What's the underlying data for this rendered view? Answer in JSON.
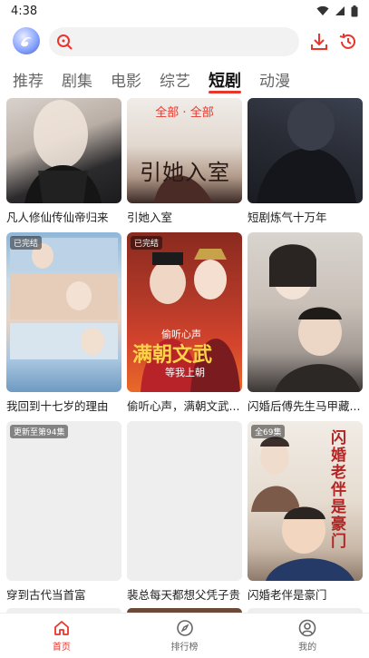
{
  "status_bar": {
    "time": "4:38"
  },
  "colors": {
    "accent": "#e8362d",
    "inactive_text": "#666666",
    "card_placeholder": "#eeeeee"
  },
  "search": {
    "placeholder": ""
  },
  "header": {
    "download_icon": "download-icon",
    "history_icon": "history-icon"
  },
  "tabs": [
    {
      "label": "推荐",
      "active": false
    },
    {
      "label": "剧集",
      "active": false
    },
    {
      "label": "电影",
      "active": false
    },
    {
      "label": "综艺",
      "active": false
    },
    {
      "label": "短剧",
      "active": true
    },
    {
      "label": "动漫",
      "active": false
    }
  ],
  "filter_label": "全部 · 全部",
  "cards": [
    {
      "title": "凡人修仙传仙帝归来",
      "badge": ""
    },
    {
      "title": "引她入室",
      "badge": "",
      "poster_text": "引她入室"
    },
    {
      "title": "短剧炼气十万年",
      "badge": ""
    },
    {
      "title": "我回到十七岁的理由",
      "badge": "已完结"
    },
    {
      "title": "偷听心声，满朝文武...",
      "badge": "已完结",
      "poster_text": "满朝文武",
      "poster_subtext": "偷听心声",
      "poster_subtext2": "等我上朝"
    },
    {
      "title": "闪婚后傅先生马甲藏...",
      "badge": ""
    },
    {
      "title": "穿到古代当首富",
      "badge": "更新至第94集"
    },
    {
      "title": "裴总每天都想父凭子贵",
      "badge": ""
    },
    {
      "title": "闪婚老伴是豪门",
      "badge": "全69集",
      "poster_text": "闪婚老伴是豪门"
    }
  ],
  "bottom_nav": [
    {
      "label": "首页",
      "icon": "home-icon",
      "active": true
    },
    {
      "label": "排行榜",
      "icon": "compass-icon",
      "active": false
    },
    {
      "label": "我的",
      "icon": "user-icon",
      "active": false
    }
  ]
}
